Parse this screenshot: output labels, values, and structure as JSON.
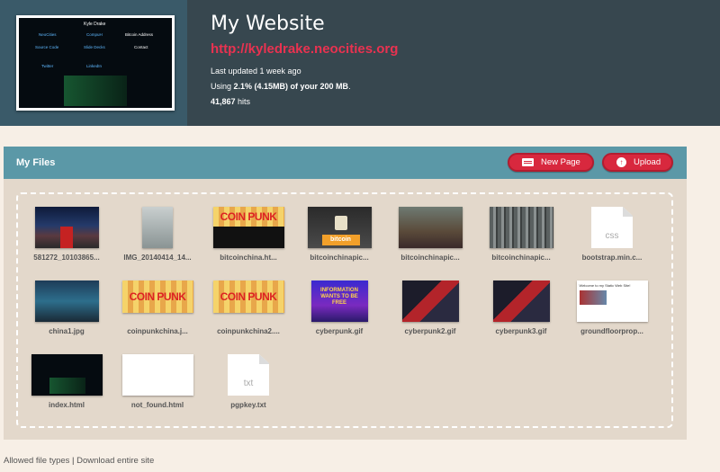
{
  "site": {
    "title": "My Website",
    "url": "http://kyledrake.neocities.org",
    "updated": "Last updated 1 week ago",
    "usage_prefix": "Using ",
    "usage_value": "2.1% (4.15MB) of your 200 MB",
    "usage_suffix": ".",
    "hits_value": "41,867",
    "hits_suffix": " hits"
  },
  "preview": {
    "name": "Kyle Drake",
    "links": [
      "NeoCities",
      "CompuH",
      "Source Code",
      "Slide Decks",
      "Twitter",
      "LinkedIn"
    ],
    "bitcoin": "Bitcoin Address",
    "contact": "Contact"
  },
  "files_panel": {
    "title": "My Files",
    "new_page": "New Page",
    "upload": "Upload"
  },
  "files": [
    {
      "name": "581272_10103865..."
    },
    {
      "name": "IMG_20140414_14..."
    },
    {
      "name": "bitcoinchina.ht..."
    },
    {
      "name": "bitcoinchinapic..."
    },
    {
      "name": "bitcoinchinapic..."
    },
    {
      "name": "bitcoinchinapic..."
    },
    {
      "name": "bootstrap.min.c...",
      "ext": "css"
    },
    {
      "name": "china1.jpg"
    },
    {
      "name": "coinpunkchina.j..."
    },
    {
      "name": "coinpunkchina2...."
    },
    {
      "name": "cyberpunk.gif"
    },
    {
      "name": "cyberpunk2.gif"
    },
    {
      "name": "cyberpunk3.gif"
    },
    {
      "name": "groundfloorprop..."
    },
    {
      "name": "index.html"
    },
    {
      "name": "not_found.html"
    },
    {
      "name": "pgpkey.txt",
      "ext": "txt"
    }
  ],
  "thumb_text": {
    "coinpunk": "COIN PUNK",
    "bitcoin": "bitcoin",
    "info": "INFORMATION WANTS TO BE FREE",
    "groundfloor": "Welcome to my Static Web Site!"
  },
  "footer": {
    "allowed": "Allowed file types",
    "sep": " | ",
    "download": "Download entire site"
  }
}
